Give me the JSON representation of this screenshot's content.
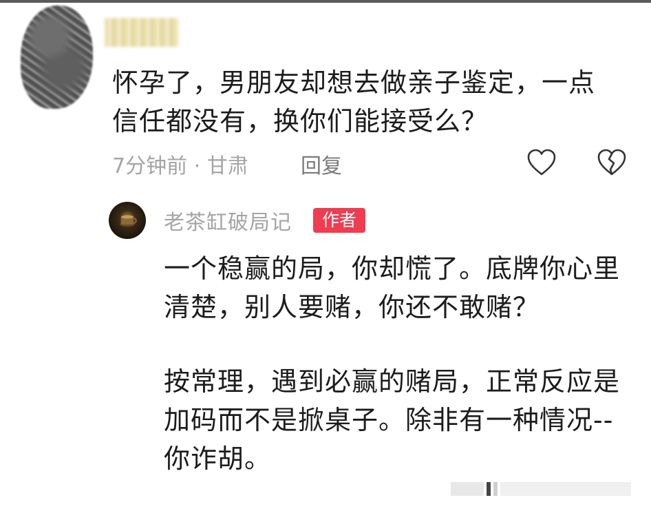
{
  "comment": {
    "text": "怀孕了，男朋友却想去做亲子鉴定，一点信任都没有，换你们能接受么？",
    "meta": "7分钟前 · 甘肃",
    "reply_label": "回复",
    "like_icon": "heart-icon",
    "dislike_icon": "broken-heart-icon"
  },
  "author_reply": {
    "name": "老茶缸破局记",
    "badge": "作者",
    "paragraph_1": "一个稳赢的局，你却慌了。底牌你心里清楚，别人要赌，你还不敢赌？",
    "paragraph_2": "按常理，遇到必赢的赌局，正常反应是加码而不是掀桌子。除非有一种情况--你诈胡。"
  },
  "colors": {
    "badge": "#f03c50",
    "meta_text": "#a4a4a4",
    "body_text": "#1c1c1c"
  }
}
